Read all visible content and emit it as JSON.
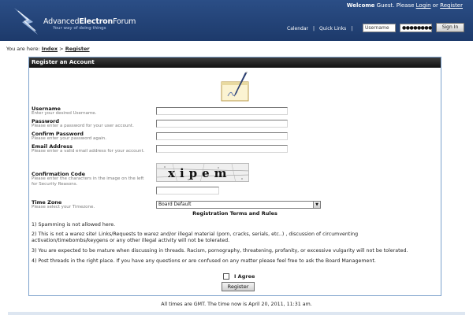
{
  "header": {
    "brand_regular": "Advanced",
    "brand_bold": "Electron",
    "brand_suffix": "Forum",
    "tagline": "Your way of doing things",
    "welcome_label": "Welcome",
    "welcome_user": "Guest.",
    "please": "Please",
    "login_link": "Login",
    "or": "or",
    "register_link": "Register",
    "nav": [
      "Calendar",
      "Quick Links"
    ],
    "username_value": "Username",
    "password_value": "●●●●●●●●",
    "signin_label": "Sign In"
  },
  "breadcrumb": {
    "prefix": "You are here:",
    "items": [
      "Index",
      "Register"
    ],
    "separator": ">"
  },
  "register": {
    "title": "Register an Account",
    "fields": [
      {
        "label": "Username",
        "hint": "Enter your desired Username."
      },
      {
        "label": "Password",
        "hint": "Please enter a password for your user account."
      },
      {
        "label": "Confirm Password",
        "hint": "Please enter your password again."
      },
      {
        "label": "Email Address",
        "hint": "Please enter a valid email address for your account."
      },
      {
        "label": "Confirmation Code",
        "hint": "Please enter the characters in the image on the left for Security Reasons."
      },
      {
        "label": "Time Zone",
        "hint": "Please select your Timezone."
      }
    ],
    "captcha_text": "xipem",
    "timezone_selected": "Board Default",
    "terms_title": "Registration Terms and Rules",
    "rules": [
      "1) Spamming is not allowed here.",
      "2) This is not a warez site! Links/Requests to warez and/or illegal material (porn, cracks, serials, etc..) , discussion of circumventing activation/timebombs/keygens or any other illegal activity will not be tolerated.",
      "3) You are expected to be mature when discussing in threads. Racism, pornography, threatening, profanity, or excessive vulgarity will not be tolerated.",
      "4) Post threads in the right place. If you have any questions or are confused on any matter please feel free to ask the Board Management."
    ],
    "agree_label": "I Agree",
    "register_button": "Register"
  },
  "footer": {
    "text": "All times are GMT. The time now is April 20, 2011, 11:31 am."
  },
  "colors": {
    "header_bg": "#1d3a6b",
    "title_bar": "#111111",
    "box_border": "#7da2cc"
  }
}
